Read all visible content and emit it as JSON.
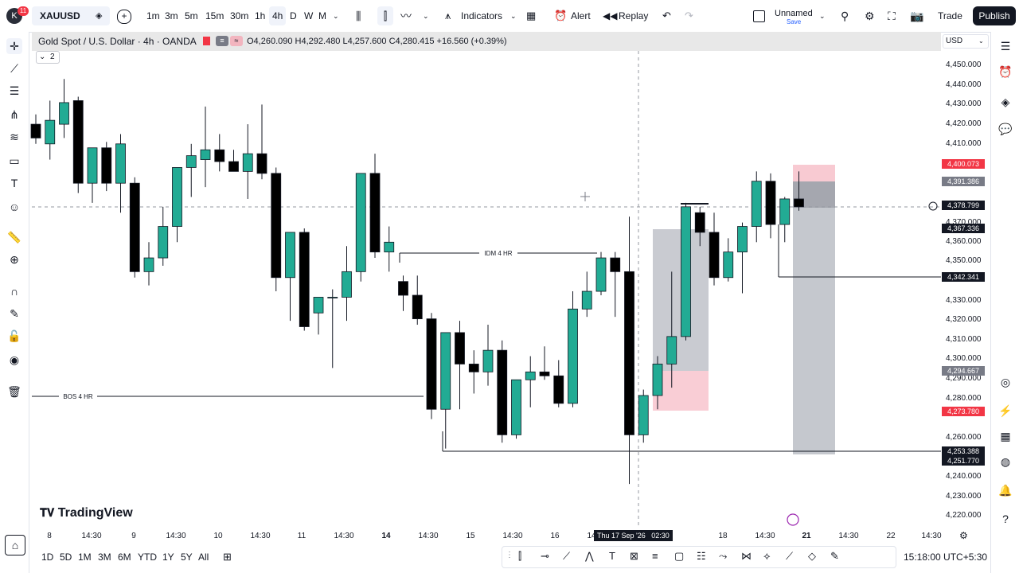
{
  "header": {
    "badge_count": "11",
    "symbol": "XAUUSD",
    "intervals": [
      "1m",
      "3m",
      "5m",
      "15m",
      "30m",
      "1h",
      "4h",
      "D",
      "W",
      "M"
    ],
    "active_interval": "4h",
    "indicators_label": "Indicators",
    "alert_label": "Alert",
    "replay_label": "Replay",
    "layout_name": "Unnamed",
    "save_label": "Save",
    "trade_label": "Trade",
    "publish_label": "Publish"
  },
  "legend": {
    "title": "Gold Spot / U.S. Dollar · 4h · OANDA",
    "ohlc": "O4,260.090 H4,292.480 L4,257.600 C4,280.415 +16.560 (+0.39%)",
    "collapse_count": "2"
  },
  "price_axis": {
    "currency": "USD",
    "labels": [
      "4,450.000",
      "4,440.000",
      "4,430.000",
      "4,420.000",
      "4,410.000",
      "4,370.000",
      "4,360.000",
      "4,350.000",
      "4,330.000",
      "4,320.000",
      "4,310.000",
      "4,300.000",
      "4,290.000",
      "4,280.000",
      "4,260.000",
      "4,240.000",
      "4,230.000",
      "4,220.000"
    ],
    "tags": [
      {
        "text": "4,400.073",
        "color": "#f23645"
      },
      {
        "text": "4,391.386",
        "color": "#787b86"
      },
      {
        "text": "4,378.799",
        "color": "#131722"
      },
      {
        "text": "4,367.336",
        "color": "#131722"
      },
      {
        "text": "4,342.341",
        "color": "#131722"
      },
      {
        "text": "4,294.667",
        "color": "#787b86"
      },
      {
        "text": "4,273.780",
        "color": "#f23645"
      },
      {
        "text": "4,253.388",
        "color": "#131722"
      },
      {
        "text": "4,251.770",
        "color": "#131722"
      }
    ]
  },
  "time_axis": {
    "labels": [
      "8",
      "14:30",
      "9",
      "14:30",
      "10",
      "14:30",
      "11",
      "14:30",
      "14",
      "14:30",
      "15",
      "14:30",
      "16",
      "14:30",
      "18",
      "14:30",
      "21",
      "14:30",
      "22",
      "14:30"
    ],
    "crosshair_label": "Thu 17 Sep '26   02:30"
  },
  "annotations": {
    "bos": "BOS 4 HR",
    "idm": "IDM 4 HR"
  },
  "brand": "TradingView",
  "bottom": {
    "ranges": [
      "1D",
      "5D",
      "1M",
      "3M",
      "6M",
      "YTD",
      "1Y",
      "5Y",
      "All"
    ],
    "clock": "15:18:00 UTC+5:30"
  },
  "colors": {
    "bull": "#22ab94",
    "bear": "#000000",
    "zone_grey": "#b2b5be",
    "zone_pink": "#f7c1ca"
  },
  "chart_data": {
    "type": "candlestick",
    "title": "",
    "ylim": [
      4215,
      4455
    ],
    "candles": [
      {
        "o": 4420,
        "h": 4425,
        "l": 4410,
        "c": 4413
      },
      {
        "o": 4410,
        "h": 4432,
        "l": 4402,
        "c": 4422
      },
      {
        "o": 4420,
        "h": 4443,
        "l": 4413,
        "c": 4431
      },
      {
        "o": 4432,
        "h": 4434,
        "l": 4385,
        "c": 4390
      },
      {
        "o": 4390,
        "h": 4405,
        "l": 4380,
        "c": 4408
      },
      {
        "o": 4408,
        "h": 4411,
        "l": 4386,
        "c": 4390
      },
      {
        "o": 4390,
        "h": 4415,
        "l": 4375,
        "c": 4410
      },
      {
        "o": 4390,
        "h": 4393,
        "l": 4342,
        "c": 4345
      },
      {
        "o": 4345,
        "h": 4360,
        "l": 4338,
        "c": 4352
      },
      {
        "o": 4352,
        "h": 4378,
        "l": 4348,
        "c": 4368
      },
      {
        "o": 4368,
        "h": 4385,
        "l": 4360,
        "c": 4398
      },
      {
        "o": 4398,
        "h": 4410,
        "l": 4383,
        "c": 4404
      },
      {
        "o": 4402,
        "h": 4429,
        "l": 4388,
        "c": 4407
      },
      {
        "o": 4407,
        "h": 4415,
        "l": 4396,
        "c": 4401
      },
      {
        "o": 4401,
        "h": 4407,
        "l": 4398,
        "c": 4396
      },
      {
        "o": 4396,
        "h": 4420,
        "l": 4382,
        "c": 4405
      },
      {
        "o": 4405,
        "h": 4430,
        "l": 4392,
        "c": 4395
      },
      {
        "o": 4395,
        "h": 4398,
        "l": 4335,
        "c": 4342
      },
      {
        "o": 4342,
        "h": 4363,
        "l": 4320,
        "c": 4365
      },
      {
        "o": 4365,
        "h": 4367,
        "l": 4315,
        "c": 4317
      },
      {
        "o": 4324,
        "h": 4326,
        "l": 4313,
        "c": 4332
      },
      {
        "o": 4332,
        "h": 4336,
        "l": 4296,
        "c": 4332
      },
      {
        "o": 4332,
        "h": 4358,
        "l": 4320,
        "c": 4345
      },
      {
        "o": 4345,
        "h": 4395,
        "l": 4340,
        "c": 4395
      },
      {
        "o": 4395,
        "h": 4405,
        "l": 4352,
        "c": 4355
      },
      {
        "o": 4355,
        "h": 4368,
        "l": 4345,
        "c": 4360
      },
      {
        "o": 4340,
        "h": 4343,
        "l": 4325,
        "c": 4333
      },
      {
        "o": 4333,
        "h": 4343,
        "l": 4318,
        "c": 4321
      },
      {
        "o": 4321,
        "h": 4324,
        "l": 4270,
        "c": 4275
      },
      {
        "o": 4275,
        "h": 4314,
        "l": 4255,
        "c": 4314
      },
      {
        "o": 4314,
        "h": 4320,
        "l": 4275,
        "c": 4298
      },
      {
        "o": 4298,
        "h": 4305,
        "l": 4283,
        "c": 4294
      },
      {
        "o": 4294,
        "h": 4318,
        "l": 4287,
        "c": 4305
      },
      {
        "o": 4305,
        "h": 4310,
        "l": 4258,
        "c": 4262
      },
      {
        "o": 4262,
        "h": 4290,
        "l": 4260,
        "c": 4290
      },
      {
        "o": 4290,
        "h": 4302,
        "l": 4276,
        "c": 4294
      },
      {
        "o": 4294,
        "h": 4307,
        "l": 4290,
        "c": 4292
      },
      {
        "o": 4292,
        "h": 4300,
        "l": 4276,
        "c": 4278
      },
      {
        "o": 4278,
        "h": 4335,
        "l": 4276,
        "c": 4326
      },
      {
        "o": 4326,
        "h": 4345,
        "l": 4322,
        "c": 4335
      },
      {
        "o": 4335,
        "h": 4355,
        "l": 4333,
        "c": 4352
      },
      {
        "o": 4352,
        "h": 4355,
        "l": 4322,
        "c": 4345
      },
      {
        "o": 4345,
        "h": 4373,
        "l": 4237,
        "c": 4262
      },
      {
        "o": 4262,
        "h": 4285,
        "l": 4258,
        "c": 4282
      },
      {
        "o": 4282,
        "h": 4302,
        "l": 4275,
        "c": 4298
      },
      {
        "o": 4298,
        "h": 4345,
        "l": 4286,
        "c": 4312
      },
      {
        "o": 4312,
        "h": 4380,
        "l": 4310,
        "c": 4378
      },
      {
        "o": 4375,
        "h": 4378,
        "l": 4358,
        "c": 4365
      },
      {
        "o": 4365,
        "h": 4375,
        "l": 4338,
        "c": 4342
      },
      {
        "o": 4342,
        "h": 4362,
        "l": 4340,
        "c": 4355
      },
      {
        "o": 4355,
        "h": 4370,
        "l": 4334,
        "c": 4368
      },
      {
        "o": 4368,
        "h": 4396,
        "l": 4360,
        "c": 4391
      },
      {
        "o": 4391,
        "h": 4395,
        "l": 4362,
        "c": 4369
      },
      {
        "o": 4369,
        "h": 4383,
        "l": 4360,
        "c": 4382
      },
      {
        "o": 4382,
        "h": 4396,
        "l": 4376,
        "c": 4378
      }
    ]
  }
}
